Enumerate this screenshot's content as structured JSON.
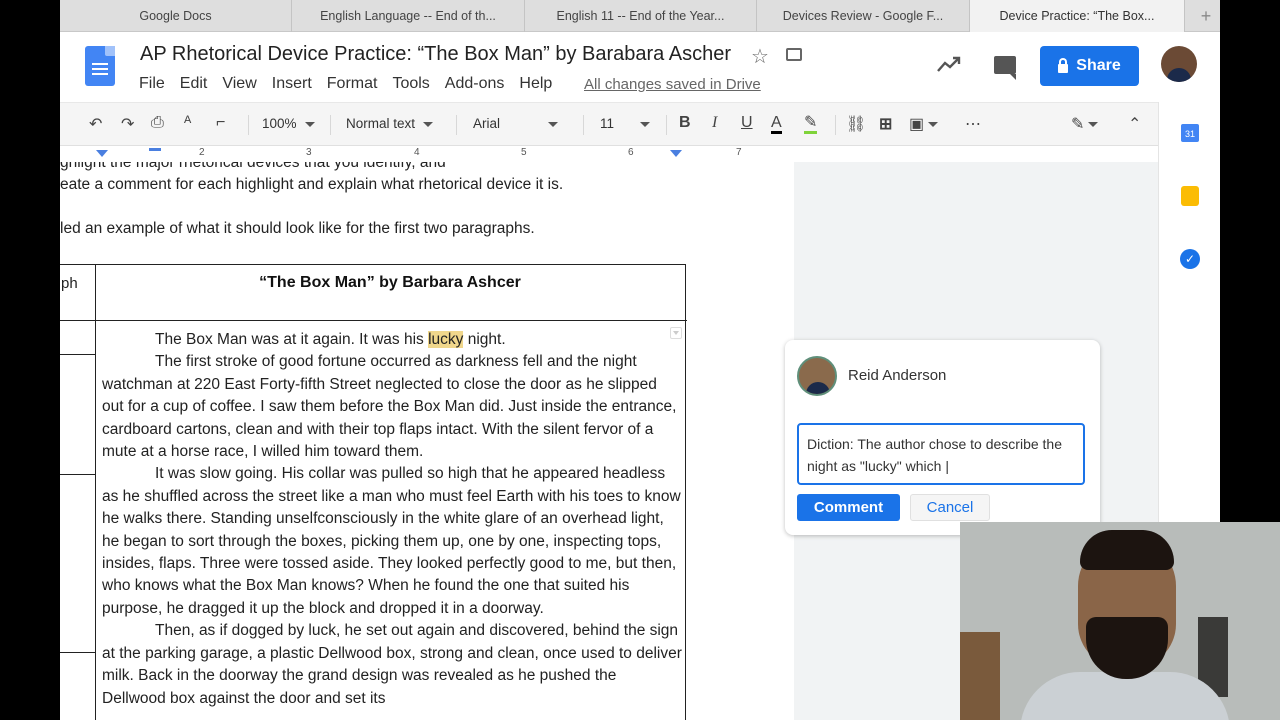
{
  "browser": {
    "tabs": [
      {
        "label": "Google Docs"
      },
      {
        "label": "English Language -- End of th..."
      },
      {
        "label": "English 11 -- End of the Year..."
      },
      {
        "label": "Devices Review - Google F..."
      },
      {
        "label": "Device Practice: “The Box..."
      }
    ],
    "new_tab": "+"
  },
  "header": {
    "doc_title": "AP Rhetorical Device Practice: “The Box Man” by Barabara Ascher",
    "menu": [
      "File",
      "Edit",
      "View",
      "Insert",
      "Format",
      "Tools",
      "Add-ons",
      "Help"
    ],
    "saved_status": "All changes saved in Drive",
    "share_label": "Share"
  },
  "toolbar": {
    "zoom": "100%",
    "style": "Normal text",
    "font": "Arial",
    "size": "11",
    "bold": "B",
    "italic": "I",
    "underline": "U",
    "text_color": "A"
  },
  "ruler": {
    "marks": [
      "2",
      "3",
      "4",
      "5",
      "6",
      "7"
    ]
  },
  "document": {
    "line1": "ghlight the major rhetorical devices that you identify, and",
    "line2": "eate a comment for each highlight and explain what rhetorical device it is.",
    "line3": "led an example of what it should look like for the first two paragraphs.",
    "table_left_header": "ph",
    "table_title": "“The Box Man” by Barbara Ashcer",
    "para1_before": "The Box Man was at it again. It was his ",
    "para1_highlight": "lucky",
    "para1_after": " night.",
    "para2": "The first stroke of good fortune occurred as darkness fell and the night watchman at 220 East Forty-fifth Street neglected to close the door as he slipped out for a cup of coffee. I saw them before the Box Man did. Just inside the entrance, cardboard cartons, clean and with their top flaps intact. With the silent fervor of a mute at a horse race, I willed him toward them.",
    "para3": "It was slow going. His collar was pulled so high that he appeared headless as he shuffled across the street like a man who must feel Earth with his toes to know he walks there. Standing unselfconsciously in the white glare of an overhead light, he began to sort through the boxes, picking them up, one by one, inspecting tops, insides, flaps. Three were tossed aside. They looked perfectly good to me, but then, who knows what the Box Man knows? When he found the one that suited his purpose, he dragged it up the block and dropped it in a doorway.",
    "para4": "Then, as if dogged by luck, he set out again and discovered, behind the sign at the parking  garage, a plastic Dellwood box, strong and clean, once used to deliver milk. Back in the doorway the grand design was revealed as he pushed the Dellwood box against the door and set its"
  },
  "comment": {
    "author": "Reid Anderson",
    "draft": "Diction: The author chose to describe the night as \"lucky\" which |",
    "submit_label": "Comment",
    "cancel_label": "Cancel"
  },
  "sidebar": {
    "calendar_day": "31",
    "tasks_check": "✓"
  },
  "colors": {
    "accent": "#1a73e8",
    "highlight": "#f0d78c"
  }
}
